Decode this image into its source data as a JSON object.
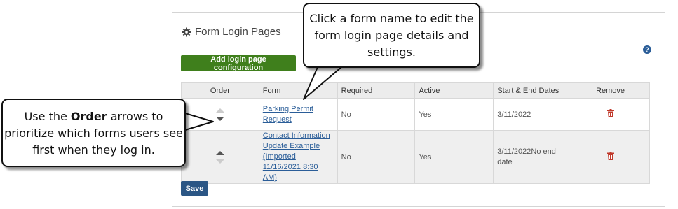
{
  "panel": {
    "title": "Form Login Pages",
    "add_button": "Add login page configuration",
    "help_icon": "?",
    "save_button": "Save"
  },
  "table": {
    "headers": [
      "Order",
      "Form",
      "Required",
      "Active",
      "Start & End Dates",
      "Remove"
    ],
    "rows": [
      {
        "form": "Parking Permit Request",
        "required": "No",
        "active": "Yes",
        "dates": "3/11/2022"
      },
      {
        "form": "Contact Information Update Example (Imported 11/16/2021 8:30 AM)",
        "required": "No",
        "active": "Yes",
        "dates": "3/11/2022No end date"
      }
    ]
  },
  "callouts": {
    "top": "Click a form name to edit the form login page details and settings.",
    "left_before": "Use the ",
    "left_bold": "Order",
    "left_after": " arrows to prioritize which forms users see first when they log in."
  },
  "colors": {
    "add_button": "#3f7f1c",
    "save_button": "#2b5685",
    "link": "#2a5d98",
    "trash": "#c0392b"
  },
  "icons": {
    "title": "gear-icon",
    "help": "question-circle-icon",
    "remove": "trash-icon",
    "order_up": "arrow-up-icon",
    "order_down": "arrow-down-icon"
  }
}
